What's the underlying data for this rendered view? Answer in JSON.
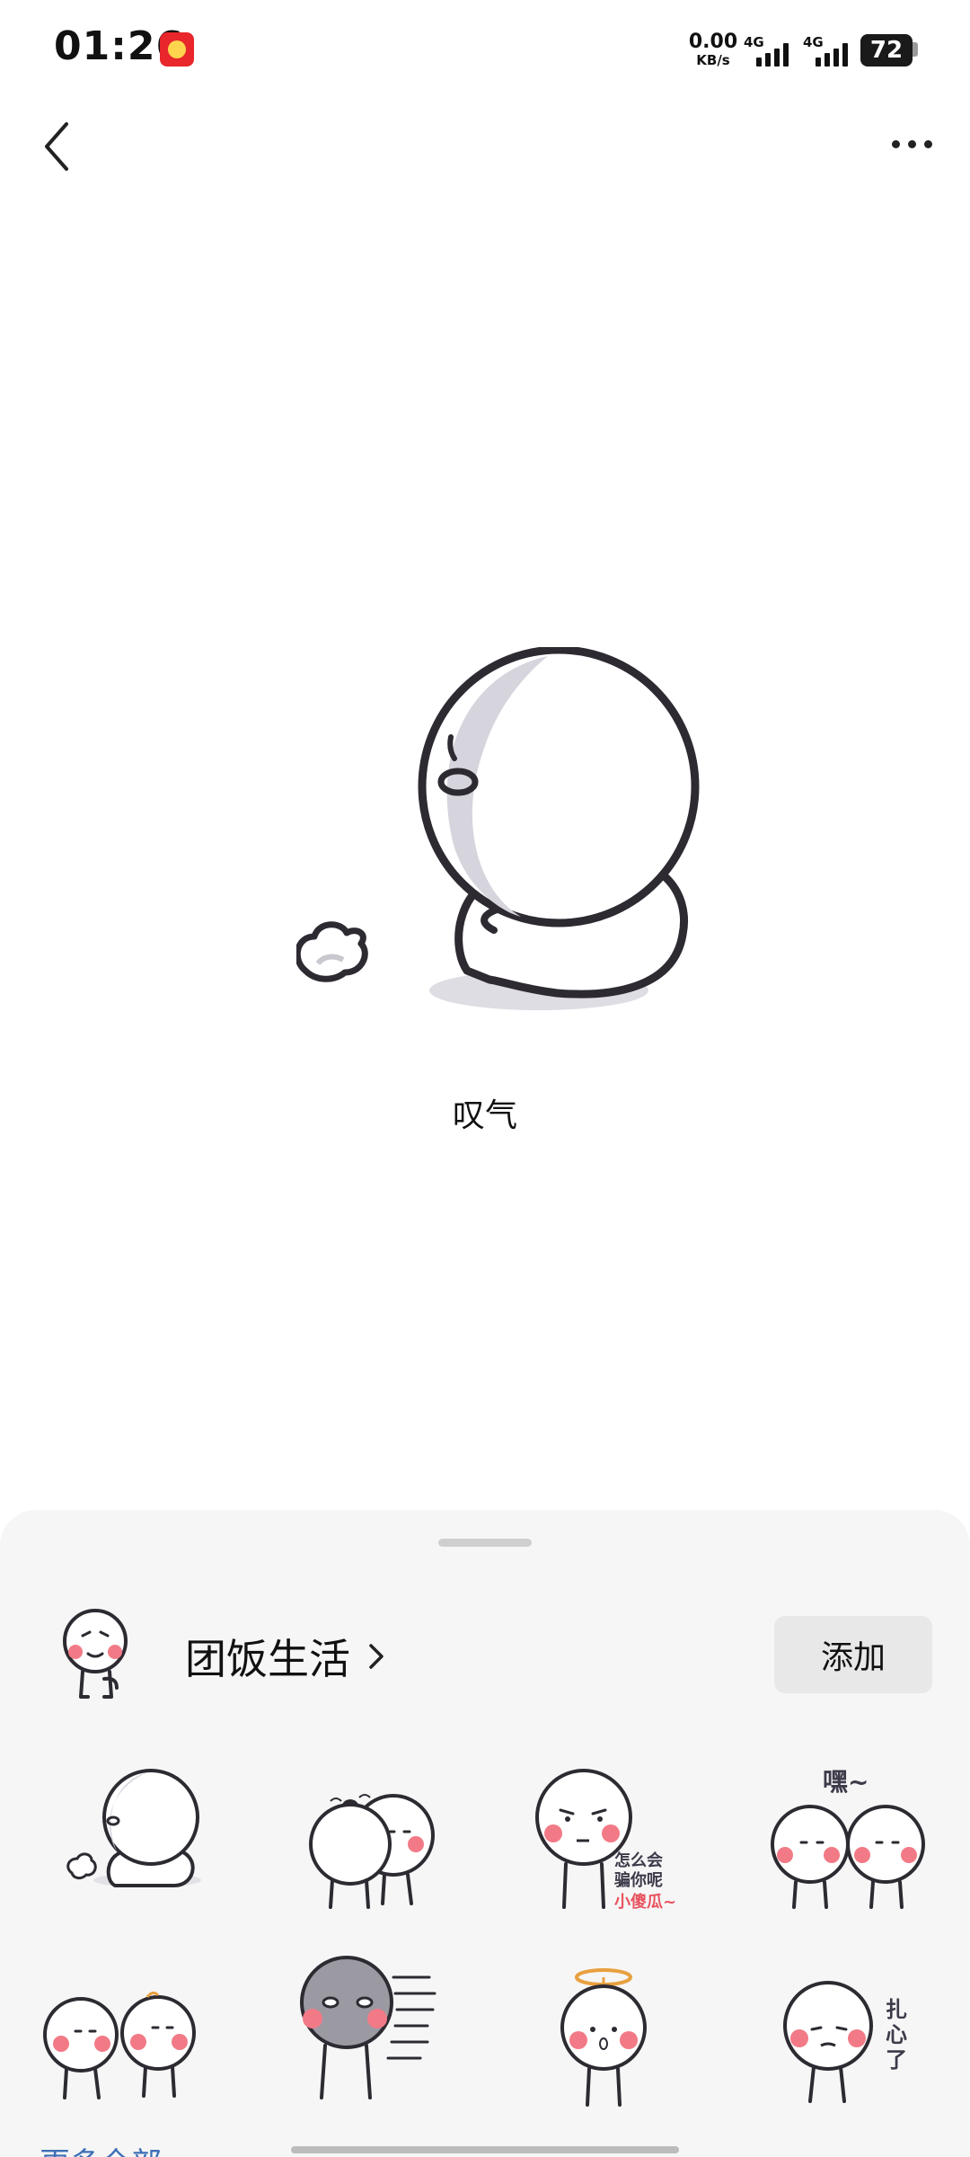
{
  "status_bar": {
    "time": "01:26",
    "net_speed_value": "0.00",
    "net_speed_unit": "KB/s",
    "sim1_label": "4G",
    "sim2_label": "4G",
    "battery": "72"
  },
  "sticker": {
    "caption": "叹气"
  },
  "sheet": {
    "pack_name": "团饭生活",
    "add_label": "添加",
    "more_link": "更多全部"
  },
  "thumbnails": [
    {
      "name": "sticker-sigh",
      "texts": []
    },
    {
      "name": "sticker-two-bump",
      "texts": []
    },
    {
      "name": "sticker-how-could-i-lie",
      "texts": [
        "怎么会",
        "骗你呢",
        "小傻瓜~"
      ]
    },
    {
      "name": "sticker-hey",
      "texts": [
        "嘿~"
      ]
    },
    {
      "name": "sticker-two-friends",
      "texts": []
    },
    {
      "name": "sticker-speed",
      "texts": []
    },
    {
      "name": "sticker-halo",
      "texts": []
    },
    {
      "name": "sticker-heartbreak",
      "texts": [
        "扎",
        "心",
        "了"
      ]
    }
  ],
  "colors": {
    "sheet_bg": "#f6f6f6",
    "button_bg": "#e8e8e8",
    "cheek": "#f27a86",
    "text_accent": "#e8525f"
  }
}
